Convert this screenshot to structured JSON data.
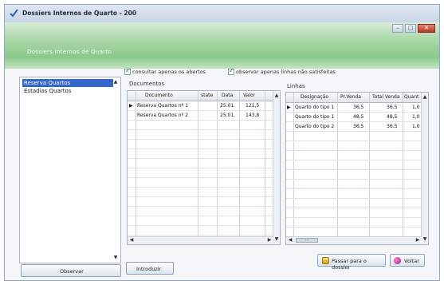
{
  "window": {
    "title": "Dossiers Internos de Quarto - 200",
    "subtitle": "Dossiers Internos de Quarto"
  },
  "left_list": {
    "items": [
      {
        "label": "Reserva Quartos",
        "selected": true
      },
      {
        "label": "Estadias Quartos",
        "selected": false
      }
    ]
  },
  "options": {
    "only_open_label": "consultar apenas os abertos",
    "only_unsatisfied_label": "observar apenas linhas não satisfeitas"
  },
  "documents": {
    "section_label": "Documentos",
    "columns": [
      "Documento",
      "state",
      "Data",
      "Valor"
    ],
    "rows": [
      {
        "documento": "Reserva Quartos nº 1",
        "state": "",
        "data": "25.01.",
        "valor": "121,5"
      },
      {
        "documento": "Reserva Quartos nº 2",
        "state": "",
        "data": "25.01.",
        "valor": "143,8"
      }
    ]
  },
  "lines": {
    "section_label": "Linhas",
    "columns": [
      "Designação",
      "Pr.Venda",
      "Total Venda",
      "Quant"
    ],
    "rows": [
      {
        "designacao": "Quarto do tipo 1",
        "pr_venda": "36,5",
        "total_venda": "36,5",
        "quant": "1,0"
      },
      {
        "designacao": "Quarto do tipo 1",
        "pr_venda": "48,5",
        "total_venda": "48,5",
        "quant": "1,0"
      },
      {
        "designacao": "Quarto do tipo 2",
        "pr_venda": "36,5",
        "total_venda": "36,5",
        "quant": "1,0"
      }
    ]
  },
  "buttons": {
    "observar": "Observar",
    "introduzir": "Introduzir",
    "passar": "Passar para o dossier",
    "voltar": "Voltar"
  },
  "colors": {
    "header_green": "#8bc98a",
    "selection_blue": "#3366cc",
    "close_red": "#b8392a"
  }
}
